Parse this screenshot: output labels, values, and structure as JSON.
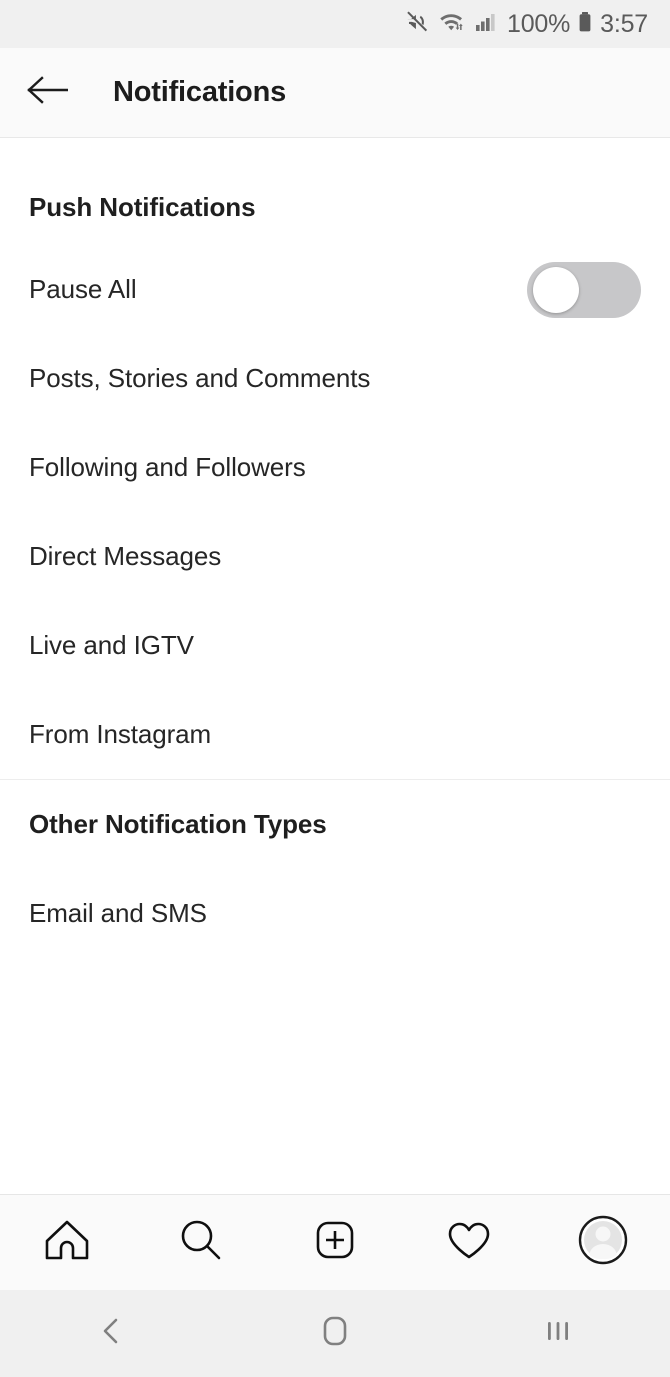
{
  "status_bar": {
    "icons": [
      "mute-icon",
      "wifi-icon",
      "cellular-signal-icon"
    ],
    "battery_percent": "100%",
    "battery_icon": "battery-full-icon",
    "time": "3:57",
    "background_color": "#f0f0f0",
    "text_color": "#5a5a5a"
  },
  "header": {
    "back_icon": "back-arrow-icon",
    "title": "Notifications",
    "background_color": "#fafafa"
  },
  "sections": [
    {
      "title": "Push Notifications",
      "rows": [
        {
          "label": "Pause All",
          "control": "toggle",
          "toggle_on": false
        },
        {
          "label": "Posts, Stories and Comments",
          "control": "none"
        },
        {
          "label": "Following and Followers",
          "control": "none"
        },
        {
          "label": "Direct Messages",
          "control": "none"
        },
        {
          "label": "Live and IGTV",
          "control": "none"
        },
        {
          "label": "From Instagram",
          "control": "none"
        }
      ]
    },
    {
      "title": "Other Notification Types",
      "rows": [
        {
          "label": "Email and SMS",
          "control": "none"
        }
      ]
    }
  ],
  "tab_bar": {
    "items": [
      {
        "name": "home-icon",
        "label": "Home"
      },
      {
        "name": "search-icon",
        "label": "Search"
      },
      {
        "name": "add-post-icon",
        "label": "New Post"
      },
      {
        "name": "heart-icon",
        "label": "Activity"
      },
      {
        "name": "profile-avatar-icon",
        "label": "Profile"
      }
    ],
    "background_color": "#fafafa"
  },
  "nav_bar": {
    "items": [
      {
        "name": "system-back-icon",
        "label": "Back"
      },
      {
        "name": "system-home-icon",
        "label": "Home"
      },
      {
        "name": "system-recents-icon",
        "label": "Recents"
      }
    ],
    "background_color": "#f0f0f0",
    "icon_color": "#808080"
  },
  "colors": {
    "text_primary": "#262626",
    "text_heading": "#1f1f1f",
    "divider": "#ededed",
    "toggle_off_track": "#c7c7c9"
  }
}
